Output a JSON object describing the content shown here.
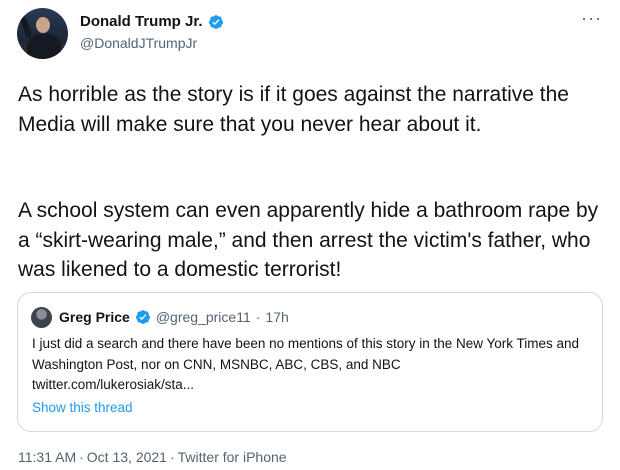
{
  "author": {
    "name": "Donald Trump Jr.",
    "handle": "@DonaldJTrumpJr"
  },
  "more_label": "···",
  "tweet": {
    "paragraph1": "As horrible as the story is if it goes against the narrative the Media will make sure that you never hear about it.",
    "paragraph2": "A school system can even apparently hide a bathroom rape by a “skirt-wearing male,” and then arrest the victim's father, who was likened to a domestic terrorist!"
  },
  "quote": {
    "name": "Greg Price",
    "handle": "@greg_price11",
    "dot": "·",
    "time": "17h",
    "text": "I just did a search and there have been no mentions of this story in the New York Times and Washington Post, nor on CNN, MSNBC, ABC, CBS, and NBC",
    "link": "twitter.com/lukerosiak/sta...",
    "show_thread": "Show this thread"
  },
  "meta": {
    "time": "11:31 AM",
    "dot": "·",
    "date": "Oct 13, 2021",
    "source": "Twitter for iPhone"
  },
  "colors": {
    "verified": "#1d9bf0",
    "link": "#1d9bf0",
    "secondary_text": "#536471",
    "border": "#cfd9de"
  }
}
